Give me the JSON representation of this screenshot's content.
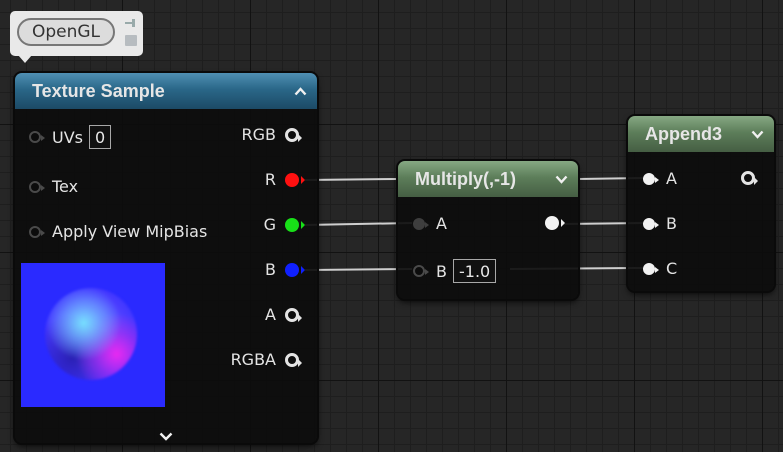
{
  "comment": {
    "label": "OpenGL"
  },
  "texture_sample": {
    "title": "Texture Sample",
    "inputs": [
      {
        "label": "UVs",
        "value": "0"
      },
      {
        "label": "Tex"
      },
      {
        "label": "Apply View MipBias"
      }
    ],
    "outputs": [
      "RGB",
      "R",
      "G",
      "B",
      "A",
      "RGBA"
    ]
  },
  "multiply": {
    "title": "Multiply(,-1)",
    "inputs": [
      {
        "label": "A"
      },
      {
        "label": "B",
        "value": "-1.0"
      }
    ]
  },
  "append": {
    "title": "Append3",
    "inputs": [
      "A",
      "B",
      "C"
    ]
  },
  "colors": {
    "red_pin": "#ff1010",
    "green_pin": "#18e018",
    "blue_pin": "#1020ff",
    "texture_header": "#2a6788",
    "math_header": "#5d7e5a"
  }
}
